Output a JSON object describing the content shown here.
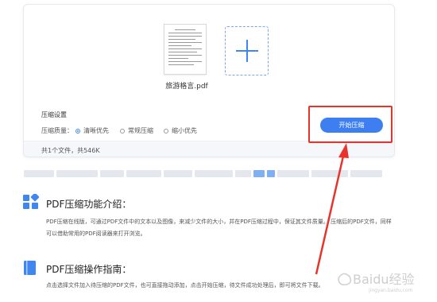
{
  "upload": {
    "file_name": "旅游格言.pdf"
  },
  "settings": {
    "title": "压缩设置",
    "quality_label": "压缩质量：",
    "options": [
      {
        "label": "清晰优先",
        "selected": true
      },
      {
        "label": "常规压缩",
        "selected": false
      },
      {
        "label": "缩小优先",
        "selected": false
      }
    ],
    "start_button": "开始压缩"
  },
  "footer": {
    "summary": "共1个文件，共546K"
  },
  "section1": {
    "title": "PDF压缩功能介绍：",
    "text": "PDF压缩在线版，可通过PDF文件中的文本以及图像，来减少文件的大小，并在PDF压缩过程中，保证其文件质量。 压缩后的PDF文件，同样可以借助常用的PDF阅读器来打开浏览。"
  },
  "section2": {
    "title": "PDF压缩操作指南：",
    "text": "点击选择文件加入待压缩的PDF文件，也可直接拖动添加，点击开始压缩，待文件成功处理后，即可将文件下载。"
  },
  "watermark": {
    "text": "Baidu经验",
    "sub": "jingyan.baidu.com"
  },
  "colors": {
    "accent": "#3d7ff0",
    "highlight": "#e8332b"
  }
}
